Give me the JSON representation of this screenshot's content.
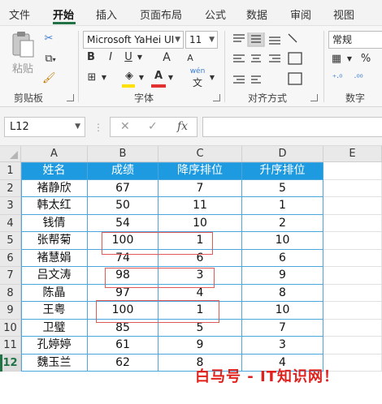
{
  "tabs": [
    "文件",
    "开始",
    "插入",
    "页面布局",
    "公式",
    "数据",
    "审阅",
    "视图"
  ],
  "active_tab": "开始",
  "accent_color": "#217346",
  "ribbon": {
    "clipboard": {
      "paste": "粘贴",
      "cut_icon": "cut-icon",
      "copy_icon": "copy-icon",
      "format_painter_icon": "format-painter-icon",
      "label": "剪贴板"
    },
    "font": {
      "font_name": "Microsoft YaHei UI",
      "font_size": "11",
      "bold": "B",
      "italic": "I",
      "underline": "U",
      "grow": "A",
      "shrink": "A",
      "font_color": "A",
      "phonetic": "wén",
      "label": "字体"
    },
    "alignment": {
      "label": "对齐方式"
    },
    "number": {
      "format": "常规",
      "percent": "%",
      "label": "数字"
    }
  },
  "formula_bar": {
    "name_box": "L12",
    "cancel": "✕",
    "enter": "✓",
    "fx": "fx",
    "value": ""
  },
  "columns": [
    "A",
    "B",
    "C",
    "D",
    "E"
  ],
  "rows": [
    "1",
    "2",
    "3",
    "4",
    "5",
    "6",
    "7",
    "8",
    "9",
    "10",
    "11",
    "12"
  ],
  "selected_row": "12",
  "headers": [
    "姓名",
    "成绩",
    "降序排位",
    "升序排位"
  ],
  "table": [
    [
      "褚静欣",
      "67",
      "7",
      "5"
    ],
    [
      "韩太红",
      "50",
      "11",
      "1"
    ],
    [
      "钱倩",
      "54",
      "10",
      "2"
    ],
    [
      "张帮菊",
      "100",
      "1",
      "10"
    ],
    [
      "褚慧娟",
      "74",
      "6",
      "6"
    ],
    [
      "吕文涛",
      "98",
      "3",
      "9"
    ],
    [
      "陈晶",
      "97",
      "4",
      "8"
    ],
    [
      "王粤",
      "100",
      "1",
      "10"
    ],
    [
      "卫璧",
      "85",
      "5",
      "7"
    ],
    [
      "孔婷婷",
      "61",
      "9",
      "3"
    ],
    [
      "魏玉兰",
      "62",
      "8",
      "4"
    ]
  ],
  "watermark": "白马号 - IT知识网！"
}
